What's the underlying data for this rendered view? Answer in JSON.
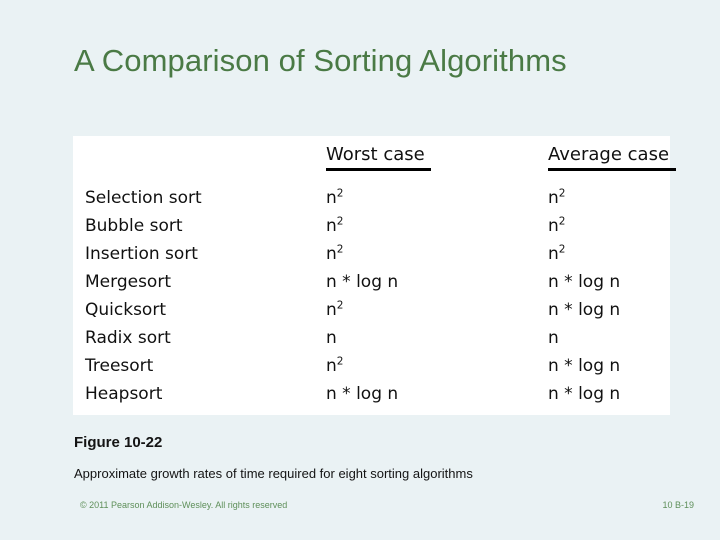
{
  "slide": {
    "title": "A Comparison of Sorting Algorithms",
    "title_color": "#4a7a45",
    "background_color": "#eaf2f4"
  },
  "figure": {
    "panel_background": "#ffffff",
    "columns": [
      {
        "key": "name",
        "label": ""
      },
      {
        "key": "worst",
        "label": "Worst case"
      },
      {
        "key": "average",
        "label": "Average case"
      }
    ],
    "rows": [
      {
        "name": "Selection sort",
        "worst_base": "n",
        "worst_exp": "2",
        "worst_text": "n2",
        "average_base": "n",
        "average_exp": "2",
        "average_text": "n2"
      },
      {
        "name": "Bubble sort",
        "worst_base": "n",
        "worst_exp": "2",
        "worst_text": "n2",
        "average_base": "n",
        "average_exp": "2",
        "average_text": "n2"
      },
      {
        "name": "Insertion sort",
        "worst_base": "n",
        "worst_exp": "2",
        "worst_text": "n2",
        "average_base": "n",
        "average_exp": "2",
        "average_text": "n2"
      },
      {
        "name": "Mergesort",
        "worst_base": "n * log n",
        "worst_exp": "",
        "worst_text": "n * log n",
        "average_base": "n * log n",
        "average_exp": "",
        "average_text": "n * log n"
      },
      {
        "name": "Quicksort",
        "worst_base": "n",
        "worst_exp": "2",
        "worst_text": "n2",
        "average_base": "n * log n",
        "average_exp": "",
        "average_text": "n * log n"
      },
      {
        "name": "Radix sort",
        "worst_base": "n",
        "worst_exp": "",
        "worst_text": "n",
        "average_base": "n",
        "average_exp": "",
        "average_text": "n"
      },
      {
        "name": "Treesort",
        "worst_base": "n",
        "worst_exp": "2",
        "worst_text": "n2",
        "average_base": "n * log n",
        "average_exp": "",
        "average_text": "n * log n"
      },
      {
        "name": "Heapsort",
        "worst_base": "n * log n",
        "worst_exp": "",
        "worst_text": "n * log n",
        "average_base": "n * log n",
        "average_exp": "",
        "average_text": "n * log n"
      }
    ],
    "label": "Figure 10-22",
    "caption": "Approximate growth rates of time required for eight sorting algorithms"
  },
  "footer": {
    "copyright": "© 2011 Pearson Addison-Wesley. All rights reserved",
    "page": "10 B-19",
    "color": "#5e8f59"
  }
}
